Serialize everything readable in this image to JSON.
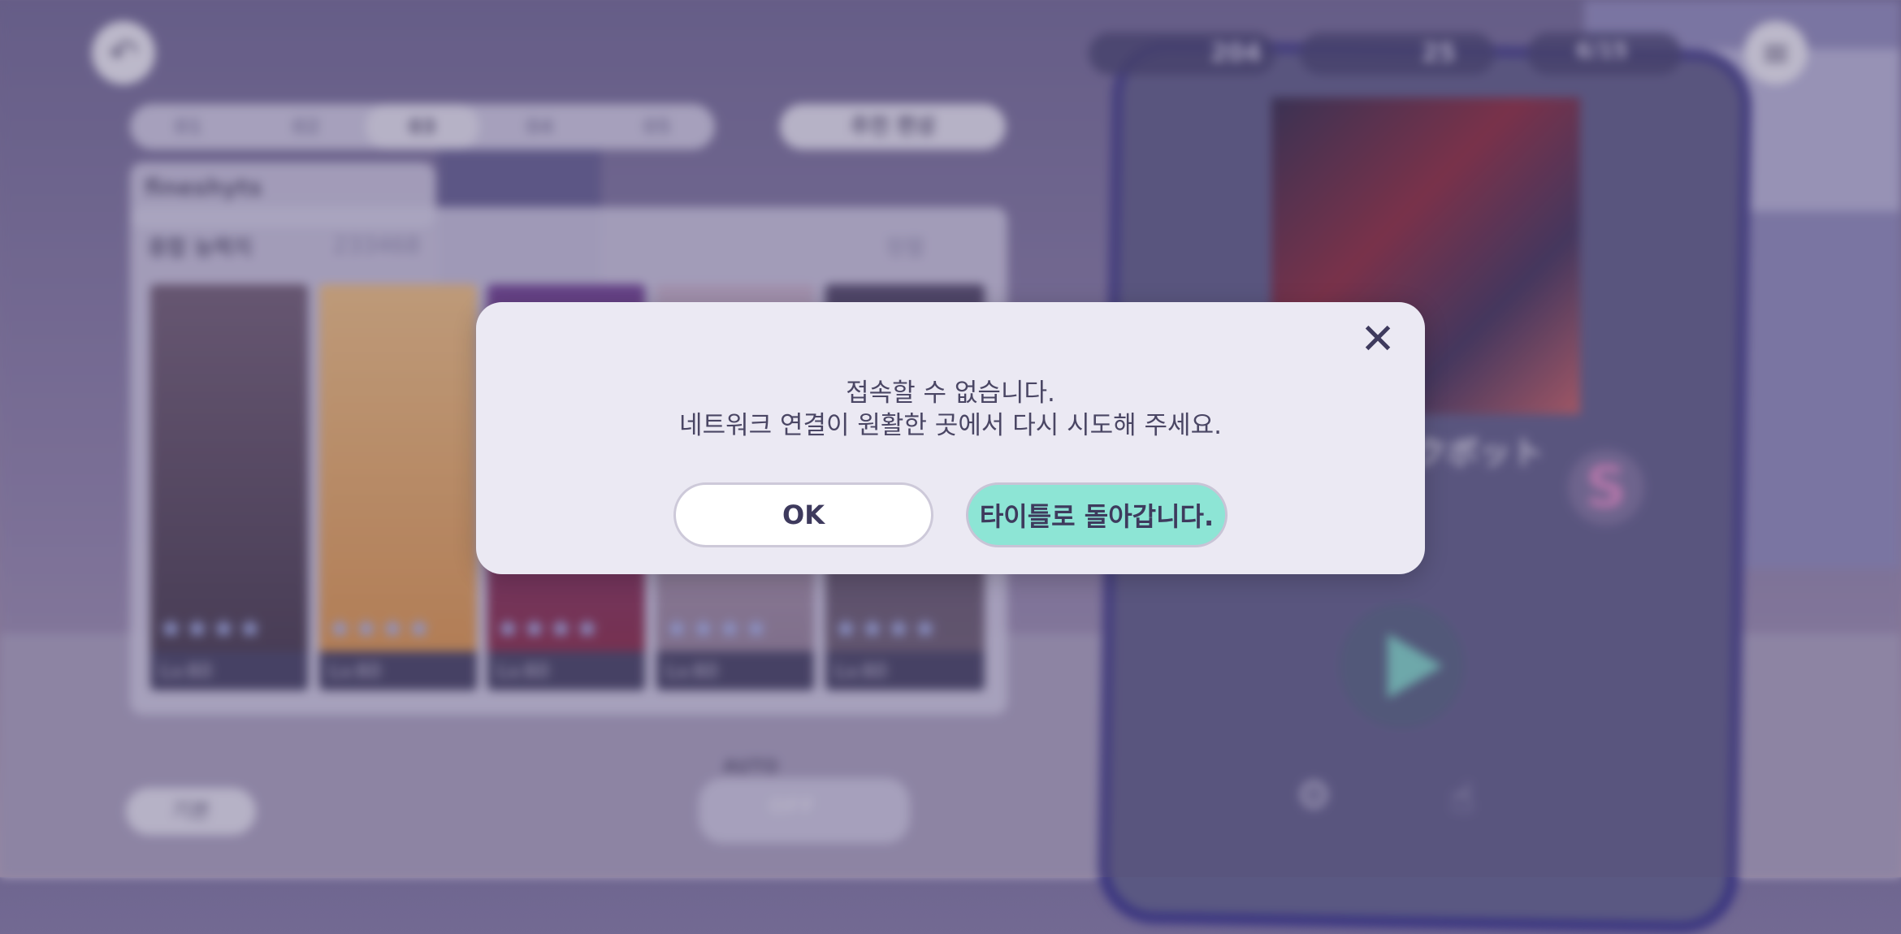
{
  "background": {
    "team_tabs": [
      "01",
      "02",
      "03",
      "04",
      "05"
    ],
    "recommend_label": "추천 편성",
    "team_name": "fineshyts",
    "power_label": "종합 능력치",
    "power_value": "233468",
    "sort_label": "정렬",
    "card_levels": [
      "Lv.60",
      "Lv.60",
      "Lv.60",
      "Lv.60",
      "Lv.60"
    ],
    "basic_label": "기본",
    "auto_label": "AUTO",
    "auto_state": "OFF",
    "crystal_count": "204",
    "energy_count": "25",
    "live_count": "6/15",
    "song_title_partial": "クボット",
    "rank_badge": "S"
  },
  "dialog": {
    "message_line1": "접속할 수 없습니다.",
    "message_line2": "네트워크 연결이 원활한 곳에서 다시 시도해 주세요.",
    "ok_label": "OK",
    "title_label": "타이틀로 돌아갑니다.",
    "close_symbol": "✕"
  },
  "colors": {
    "dialog_bg": "#ebe9f3",
    "accent_button": "#8de5d5",
    "text_dark": "#3e3a5d"
  }
}
